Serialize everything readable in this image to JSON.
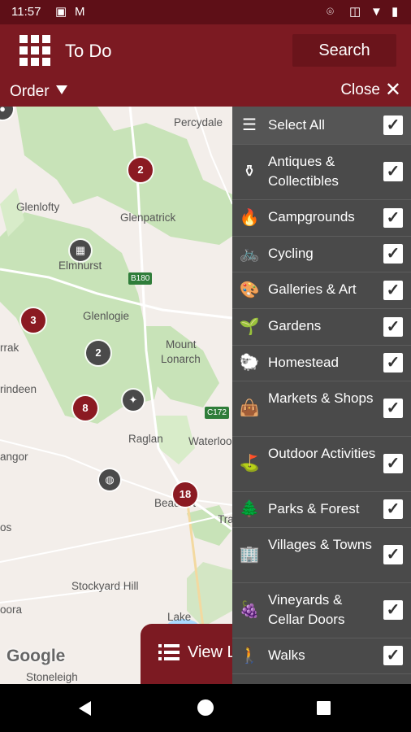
{
  "status_bar": {
    "time": "11:57",
    "icons": [
      "image-icon",
      "gmail-icon",
      "location-icon",
      "vibrate-icon",
      "wifi-icon",
      "battery-icon"
    ]
  },
  "app_bar": {
    "title": "To Do",
    "search_label": "Search",
    "menu_icon": "grid-icon"
  },
  "sub_bar": {
    "order_label": "Order",
    "close_label": "Close"
  },
  "map": {
    "places": [
      "Percydale",
      "Glenlofty",
      "Glenpatrick",
      "Elmhurst",
      "Glenlogie",
      "Mount",
      "Lonarch",
      "rrak",
      "rindeen",
      "Raglan",
      "Waterloo",
      "angor",
      "Beaufort",
      "Tra",
      "os",
      "Stockyard Hill",
      "oora",
      "Lake",
      "Stoneleigh"
    ],
    "road_badges": [
      "B180",
      "C172"
    ],
    "clusters": [
      "2",
      "3",
      "2",
      "8",
      "18"
    ],
    "attribution": "Google",
    "view_button_label": "View L"
  },
  "filters": {
    "select_all": "Select All",
    "items": [
      {
        "label": "Antiques & Collectibles",
        "icon": "antiques-icon",
        "glyph": "⚱"
      },
      {
        "label": "Campgrounds",
        "icon": "campfire-icon",
        "glyph": "🔥"
      },
      {
        "label": "Cycling",
        "icon": "bicycle-icon",
        "glyph": "🚲"
      },
      {
        "label": "Galleries & Art",
        "icon": "palette-icon",
        "glyph": "🎨"
      },
      {
        "label": "Gardens",
        "icon": "plant-pots-icon",
        "glyph": "🌱"
      },
      {
        "label": "Homestead",
        "icon": "sheep-icon",
        "glyph": "🐑"
      },
      {
        "label": "Markets & Shops",
        "icon": "shopping-bag-icon",
        "glyph": "👜"
      },
      {
        "label": "Outdoor Activities",
        "icon": "signpost-icon",
        "glyph": "⛳"
      },
      {
        "label": "Parks & Forest",
        "icon": "trees-icon",
        "glyph": "🌲"
      },
      {
        "label": "Villages & Towns",
        "icon": "buildings-icon",
        "glyph": "🏢"
      },
      {
        "label": "Vineyards & Cellar Doors",
        "icon": "grapes-icon",
        "glyph": "🍇"
      },
      {
        "label": "Walks",
        "icon": "hiker-icon",
        "glyph": "🚶"
      }
    ],
    "checkbox_glyph": "✓",
    "all_checked": true
  },
  "colors": {
    "brand": "#7c1a22",
    "panel": "#4a4a4a",
    "map_green": "#c8e3b8"
  }
}
